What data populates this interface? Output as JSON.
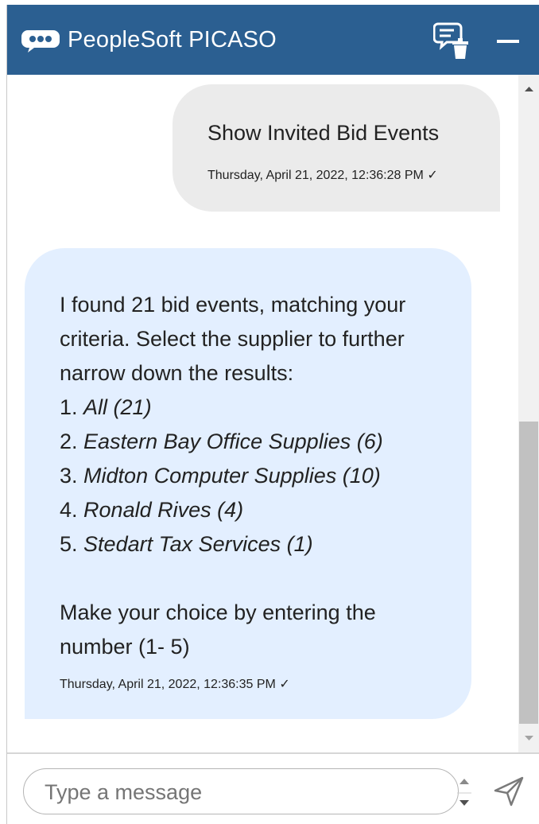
{
  "header": {
    "title": "PeopleSoft PICASO",
    "colors": {
      "header_bg": "#2b5f91",
      "user_bubble": "#ebebeb",
      "bot_bubble": "#e3efff"
    }
  },
  "messages": {
    "user": {
      "text": "Show Invited Bid Events",
      "timestamp": "Thursday, April 21, 2022, 12:36:28 PM ✓"
    },
    "bot": {
      "intro_lines": [
        "I found 21 bid events, matching your",
        "criteria. Select the supplier to further",
        "narrow down the results:"
      ],
      "options": [
        {
          "num": "1.",
          "label": "All (21)"
        },
        {
          "num": "2.",
          "label": "Eastern Bay Office Supplies (6)"
        },
        {
          "num": "3.",
          "label": "Midton Computer Supplies (10)"
        },
        {
          "num": "4.",
          "label": "Ronald Rives (4)"
        },
        {
          "num": "5.",
          "label": "Stedart Tax Services (1)"
        }
      ],
      "prompt_lines": [
        "Make your choice by entering the",
        "number (1- 5)"
      ],
      "timestamp": "Thursday, April 21, 2022, 12:36:35 PM ✓"
    }
  },
  "composer": {
    "placeholder": "Type a message",
    "value": ""
  },
  "icons": {
    "logo": "chat-bubble-dots-icon",
    "clear": "clear-conversation-icon",
    "minimize": "minimize-icon",
    "send": "send-icon"
  }
}
